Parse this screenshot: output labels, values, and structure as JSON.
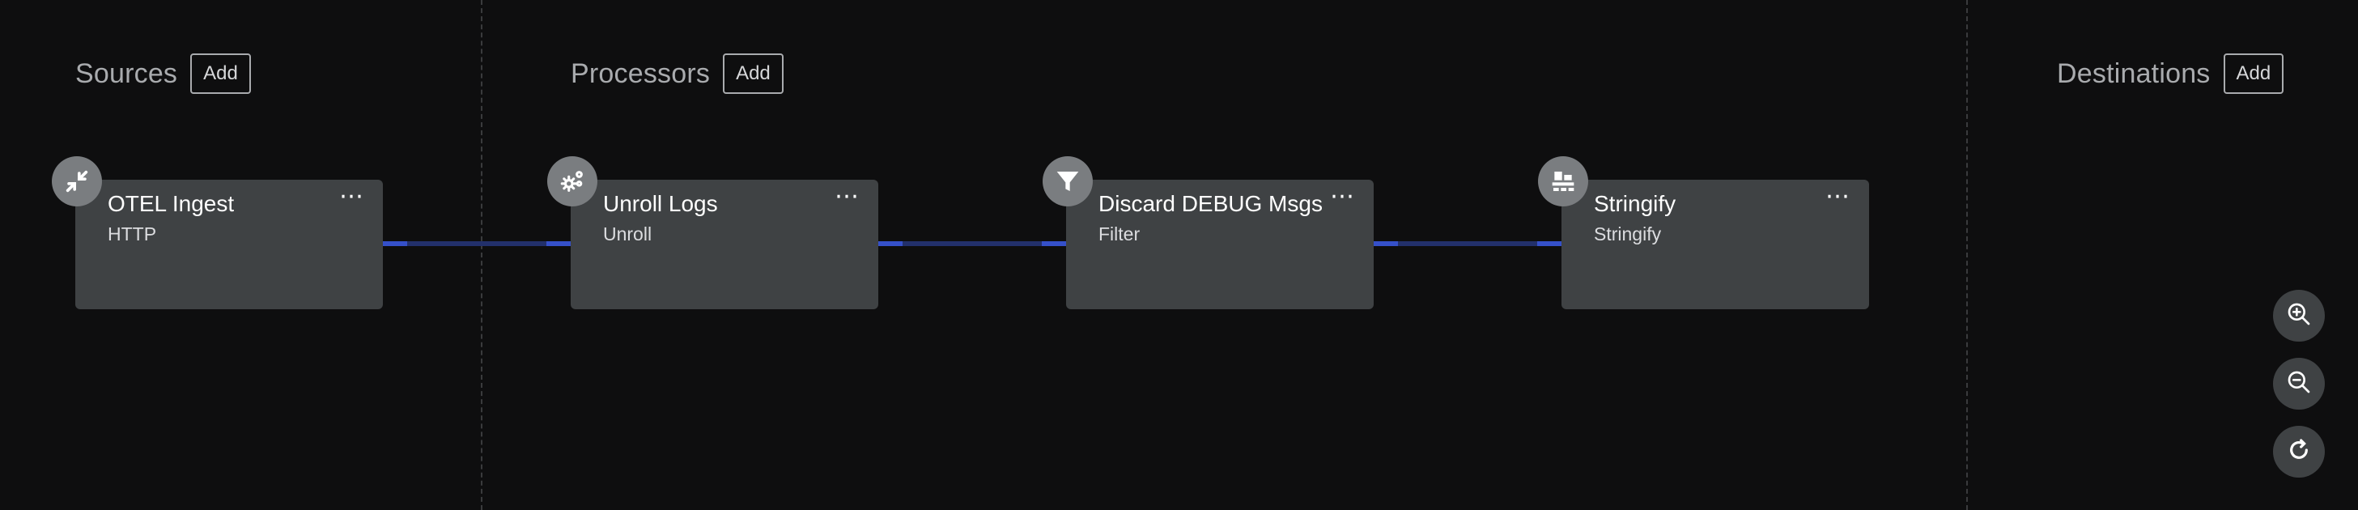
{
  "columns": {
    "sources": {
      "title": "Sources",
      "add_label": "Add"
    },
    "processors": {
      "title": "Processors",
      "add_label": "Add"
    },
    "destinations": {
      "title": "Destinations",
      "add_label": "Add"
    }
  },
  "nodes": [
    {
      "title": "OTEL Ingest",
      "subtitle": "HTTP",
      "icon": "compress-arrows-icon",
      "menu": "⋯"
    },
    {
      "title": "Unroll Logs",
      "subtitle": "Unroll",
      "icon": "gears-icon",
      "menu": "⋯"
    },
    {
      "title": "Discard DEBUG Msgs",
      "subtitle": "Filter",
      "icon": "filter-funnel-icon",
      "menu": "⋯"
    },
    {
      "title": "Stringify",
      "subtitle": "Stringify",
      "icon": "stringify-blocks-icon",
      "menu": "⋯"
    }
  ],
  "controls": {
    "zoom_in_icon": "zoom-in-icon",
    "zoom_out_icon": "zoom-out-icon",
    "reset_icon": "refresh-icon"
  },
  "colors": {
    "background": "#0e0e0f",
    "node": "#3f4244",
    "edge": "#22306b",
    "edge_accent": "#3550c9"
  }
}
